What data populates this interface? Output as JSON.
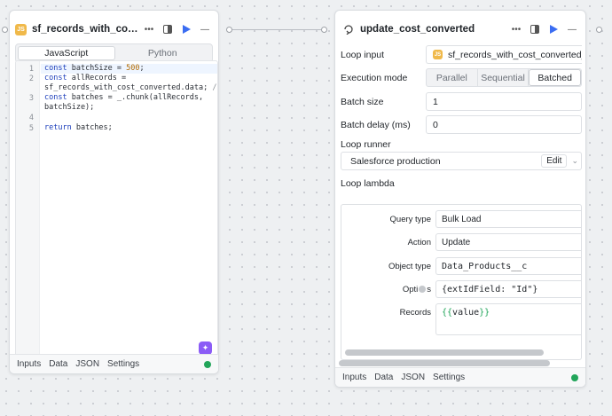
{
  "left_block": {
    "title": "sf_records_with_cost_co...",
    "badge": "JS",
    "tabs": [
      "JavaScript",
      "Python"
    ],
    "line_numbers": [
      "1",
      "2",
      "",
      "3",
      "",
      "4",
      "5"
    ],
    "code": {
      "l1_kw": "const",
      "l1_rest": " batchSize = ",
      "l1_num": "500",
      "l1_end": ";",
      "l2_kw": "const",
      "l2_rest": " allRecords =",
      "l2b_text": "sf_records_with_cost_converted.data;",
      "l2b_cmt": " //",
      "l3_kw": "const",
      "l3_rest": " batches = _.chunk(allRecords,",
      "l3b": "batchSize);",
      "l5_kw": "return",
      "l5_rest": " batches;"
    },
    "footer": [
      "Inputs",
      "Data",
      "JSON",
      "Settings"
    ]
  },
  "right_block": {
    "title": "update_cost_converted",
    "loop_input_label": "Loop input",
    "loop_input_badge": "JS",
    "loop_input_value": "sf_records_with_cost_converted_in_c",
    "execution_mode_label": "Execution mode",
    "execution_modes": [
      "Parallel",
      "Sequential",
      "Batched"
    ],
    "execution_mode_selected": "Batched",
    "batch_size_label": "Batch size",
    "batch_size": "1",
    "batch_delay_label": "Batch delay (ms)",
    "batch_delay": "0",
    "loop_runner_label": "Loop runner",
    "loop_runner_value": "Salesforce production",
    "edit_label": "Edit",
    "loop_lambda_label": "Loop lambda",
    "lambda": {
      "query_type_label": "Query type",
      "query_type": "Bulk Load",
      "action_label": "Action",
      "action": "Update",
      "object_type_label": "Object type",
      "object_type": "Data_Products__c",
      "options_label_a": "Opti",
      "options_label_b": "s",
      "options": "{extIdField: \"Id\"}",
      "records_label": "Records",
      "records_open": "{{",
      "records_value": "value",
      "records_close": "}}"
    },
    "footer": [
      "Inputs",
      "Data",
      "JSON",
      "Settings"
    ]
  },
  "colors": {
    "accent": "#3b6df2",
    "js_badge": "#f0b94a",
    "status_ok": "#22a55a"
  }
}
